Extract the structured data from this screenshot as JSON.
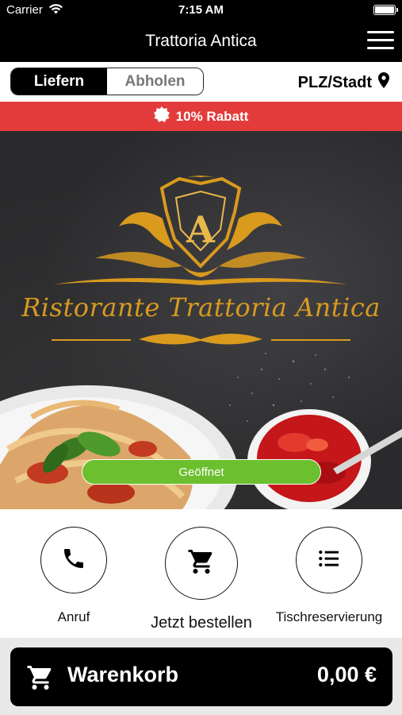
{
  "status_bar": {
    "carrier": "Carrier",
    "time": "7:15 AM"
  },
  "header": {
    "title": "Trattoria Antica"
  },
  "mode": {
    "deliver": "Liefern",
    "pickup": "Abholen",
    "active": "Liefern",
    "location": "PLZ/Stadt"
  },
  "promo": {
    "text": "10% Rabatt"
  },
  "hero": {
    "brand_text": "Ristorante Trattoria Antica",
    "monogram": "A",
    "status": "Geöffnet"
  },
  "actions": [
    {
      "label": "Anruf",
      "icon": "phone-icon"
    },
    {
      "label": "Jetzt bestellen",
      "icon": "cart-icon"
    },
    {
      "label": "Tischreservierung",
      "icon": "list-icon"
    }
  ],
  "cart": {
    "label": "Warenkorb",
    "total": "0,00 €"
  },
  "colors": {
    "promo": "#e33b3b",
    "status": "#6cbf2e",
    "gold": "#d99a1e",
    "dark": "#000000"
  }
}
